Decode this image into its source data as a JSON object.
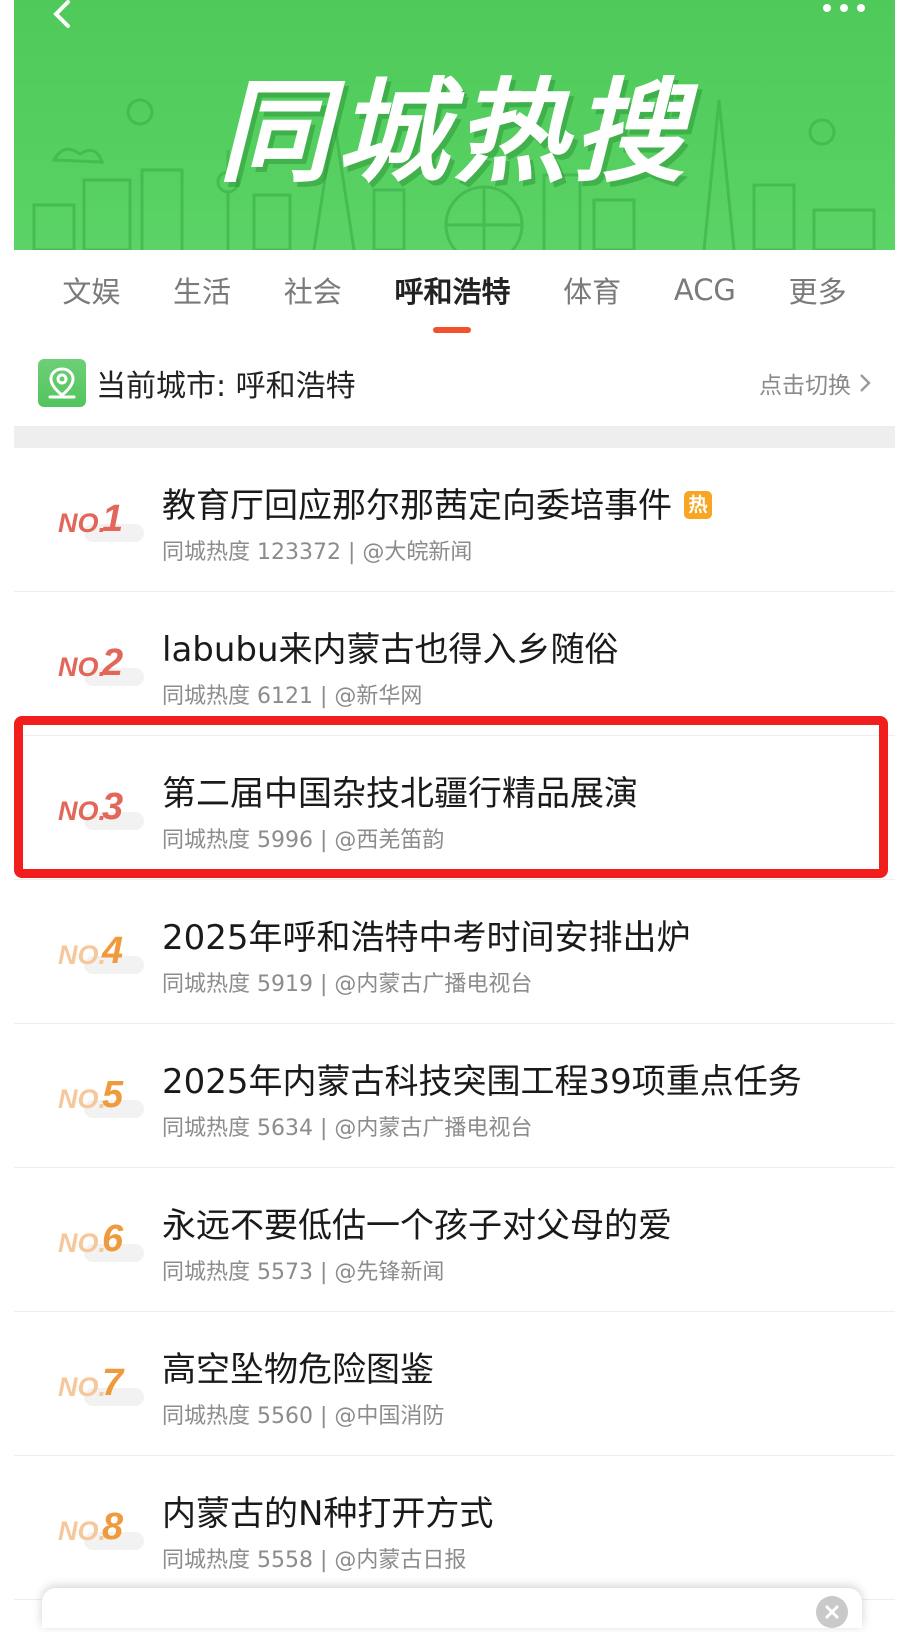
{
  "banner": {
    "title": "同城热搜"
  },
  "tabs": [
    {
      "label": "文娱",
      "active": false
    },
    {
      "label": "生活",
      "active": false
    },
    {
      "label": "社会",
      "active": false
    },
    {
      "label": "呼和浩特",
      "active": true
    },
    {
      "label": "体育",
      "active": false
    },
    {
      "label": "ACG",
      "active": false
    },
    {
      "label": "更多",
      "active": false
    }
  ],
  "city": {
    "label": "当前城市: 呼和浩特",
    "switch_label": "点击切换"
  },
  "rank_prefix": "NO.",
  "items": [
    {
      "rank": "1",
      "title": "教育厅回应那尔那茜定向委培事件",
      "badge": "热",
      "meta": "同城热度 123372 | @大皖新闻"
    },
    {
      "rank": "2",
      "title": "labubu来内蒙古也得入乡随俗",
      "badge": "",
      "meta": "同城热度 6121 | @新华网"
    },
    {
      "rank": "3",
      "title": "第二届中国杂技北疆行精品展演",
      "badge": "",
      "meta": "同城热度 5996 | @西羌笛韵"
    },
    {
      "rank": "4",
      "title": "2025年呼和浩特中考时间安排出炉",
      "badge": "",
      "meta": "同城热度 5919 | @内蒙古广播电视台"
    },
    {
      "rank": "5",
      "title": "2025年内蒙古科技突围工程39项重点任务",
      "badge": "",
      "meta": "同城热度 5634 | @内蒙古广播电视台"
    },
    {
      "rank": "6",
      "title": "永远不要低估一个孩子对父母的爱",
      "badge": "",
      "meta": "同城热度 5573 | @先锋新闻"
    },
    {
      "rank": "7",
      "title": "高空坠物危险图鉴",
      "badge": "",
      "meta": "同城热度 5560 | @中国消防"
    },
    {
      "rank": "8",
      "title": "内蒙古的N种打开方式",
      "badge": "",
      "meta": "同城热度 5558 | @内蒙古日报"
    }
  ],
  "colors": {
    "banner_green": "#52cc5d",
    "accent": "#f1512e",
    "rank_top": "#e2665a",
    "rank_mid": "#ef9a3c",
    "highlight": "#f21d1d"
  },
  "icons": {
    "back": "chevron-left-icon",
    "more": "more-dots-icon",
    "city": "location-pin-icon",
    "switch": "chevron-right-icon",
    "close": "close-icon"
  }
}
